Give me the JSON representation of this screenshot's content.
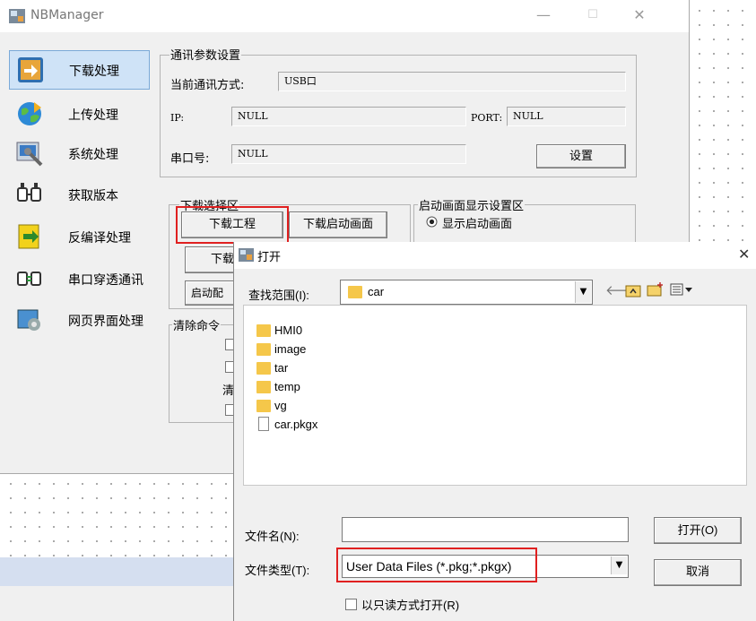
{
  "main_window": {
    "title": "NBManager",
    "minimize": "—",
    "maximize": "☐",
    "close": "✕"
  },
  "sidebar": {
    "items": [
      {
        "label": "下载处理",
        "icon": "download-process-icon"
      },
      {
        "label": "上传处理",
        "icon": "upload-globe-icon"
      },
      {
        "label": "系统处理",
        "icon": "system-tools-icon"
      },
      {
        "label": "获取版本",
        "icon": "get-version-icon"
      },
      {
        "label": "反编译处理",
        "icon": "decompile-icon"
      },
      {
        "label": "串口穿透通讯",
        "icon": "serial-passthrough-icon"
      },
      {
        "label": "网页界面处理",
        "icon": "web-ui-icon"
      }
    ]
  },
  "comm": {
    "group_title": "通讯参数设置",
    "mode_label": "当前通讯方式:",
    "mode_value": "USB口",
    "ip_label": "IP:",
    "ip_value": "NULL",
    "port_label": "PORT:",
    "port_value": "NULL",
    "serial_label": "串口号:",
    "serial_value": "NULL",
    "settings_button": "设置"
  },
  "download": {
    "group_title": "下载选择区",
    "download_project": "下载工程",
    "download_splash": "下载启动画面",
    "download_partial": "下载",
    "startup_config_partial": "启动配"
  },
  "splash": {
    "group_title": "启动画面显示设置区",
    "show_splash": "显示启动画面"
  },
  "clear": {
    "group_title": "清除命令",
    "partial_char": "清"
  },
  "dialog": {
    "title": "打开",
    "close": "✕",
    "lookin_label": "查找范围(I):",
    "lookin_value": "car",
    "files": [
      {
        "name": "HMI0",
        "type": "folder"
      },
      {
        "name": "image",
        "type": "folder"
      },
      {
        "name": "tar",
        "type": "folder"
      },
      {
        "name": "temp",
        "type": "folder"
      },
      {
        "name": "vg",
        "type": "folder"
      },
      {
        "name": "car.pkgx",
        "type": "file"
      }
    ],
    "filename_label": "文件名(N):",
    "filename_value": "",
    "filetype_label": "文件类型(T):",
    "filetype_value": "User Data Files (*.pkg;*.pkgx)",
    "open_button": "打开(O)",
    "cancel_button": "取消",
    "readonly_label": "以只读方式打开(R)"
  },
  "colors": {
    "highlight": "#e02020",
    "selected_nav": "#cfe3f7"
  }
}
